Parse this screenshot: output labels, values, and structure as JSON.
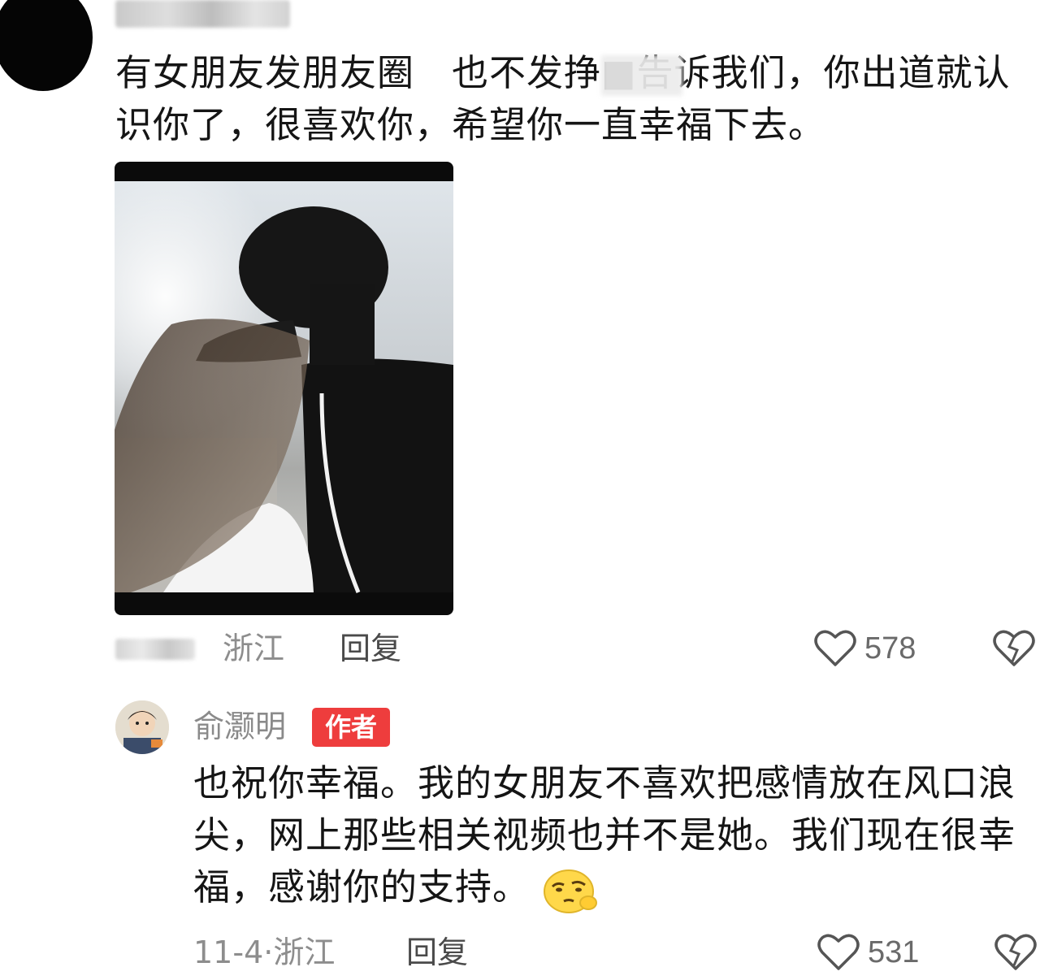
{
  "top_comment": {
    "text": "有女朋友发朋友圈　也不发挣■告诉我们，你出道就认识你了，很喜欢你，希望你一直幸福下去。",
    "location": "浙江",
    "reply_label": "回复",
    "like_count": "578"
  },
  "reply_comment": {
    "username": "俞灏明",
    "badge": "作者",
    "text": "也祝你幸福。我的女朋友不喜欢把感情放在风口浪尖，网上那些相关视频也并不是她。我们现在很幸福，感谢你的支持。",
    "date_location": "11-4·浙江",
    "reply_label": "回复",
    "like_count": "531",
    "emoji": "thinking-face-emoji"
  },
  "icons": {
    "like": "heart-outline-icon",
    "dislike": "broken-heart-icon"
  },
  "colors": {
    "badge": "#ee3d3d",
    "meta_text": "#8d8d8d"
  }
}
